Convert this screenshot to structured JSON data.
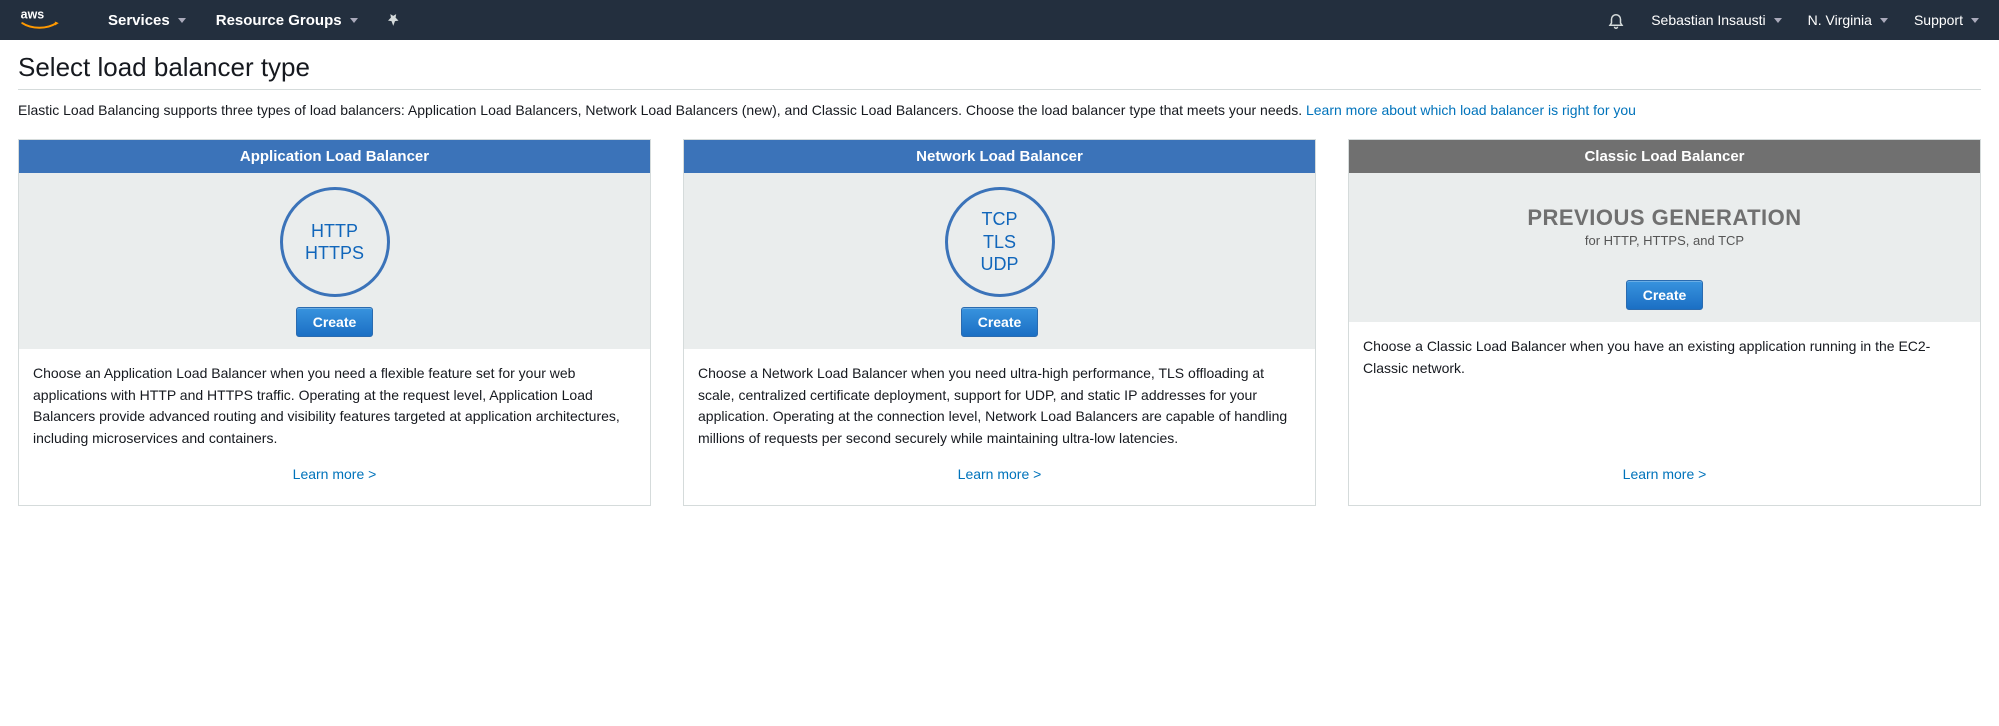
{
  "nav": {
    "services": "Services",
    "resource_groups": "Resource Groups",
    "user": "Sebastian Insausti",
    "region": "N. Virginia",
    "support": "Support"
  },
  "page": {
    "title": "Select load balancer type",
    "intro_text": "Elastic Load Balancing supports three types of load balancers: Application Load Balancers, Network Load Balancers (new), and Classic Load Balancers. Choose the load balancer type that meets your needs. ",
    "intro_link": "Learn more about which load balancer is right for you"
  },
  "cards": {
    "alb": {
      "title": "Application Load Balancer",
      "protocols": [
        "HTTP",
        "HTTPS"
      ],
      "create": "Create",
      "description": "Choose an Application Load Balancer when you need a flexible feature set for your web applications with HTTP and HTTPS traffic. Operating at the request level, Application Load Balancers provide advanced routing and visibility features targeted at application architectures, including microservices and containers.",
      "learn_more": "Learn more >"
    },
    "nlb": {
      "title": "Network Load Balancer",
      "protocols": [
        "TCP",
        "TLS",
        "UDP"
      ],
      "create": "Create",
      "description": "Choose a Network Load Balancer when you need ultra-high performance, TLS offloading at scale, centralized certificate deployment, support for UDP, and static IP addresses for your application. Operating at the connection level, Network Load Balancers are capable of handling millions of requests per second securely while maintaining ultra-low latencies.",
      "learn_more": "Learn more >"
    },
    "clb": {
      "title": "Classic Load Balancer",
      "prev_gen_title": "PREVIOUS GENERATION",
      "prev_gen_sub": "for HTTP, HTTPS, and TCP",
      "create": "Create",
      "description": "Choose a Classic Load Balancer when you have an existing application running in the EC2-Classic network.",
      "learn_more": "Learn more >"
    }
  }
}
